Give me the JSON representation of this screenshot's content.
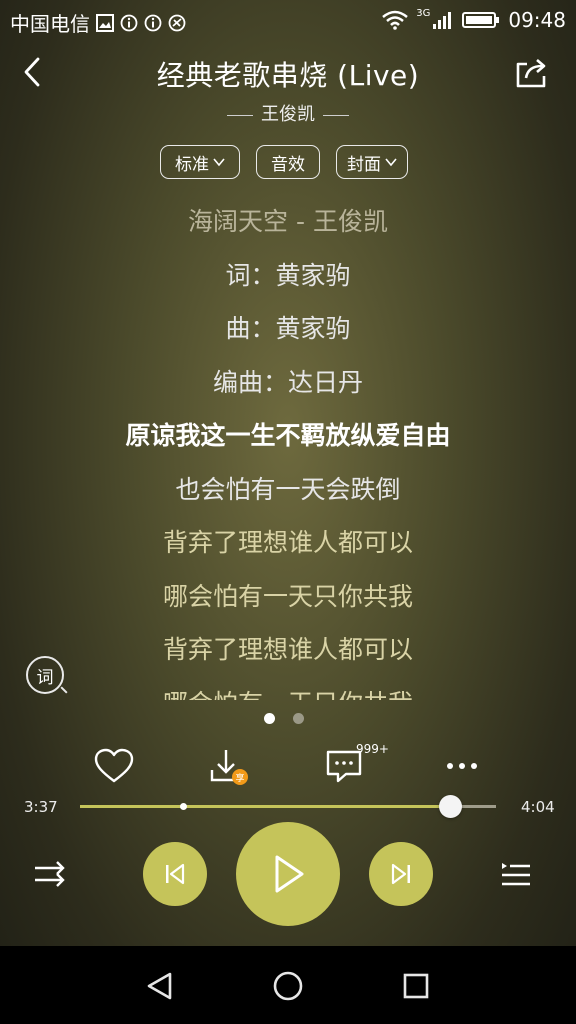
{
  "status_bar": {
    "carrier": "中国电信",
    "network": "3G",
    "time": "09:48"
  },
  "header": {
    "title": "经典老歌串烧 (Live)",
    "artist": "王俊凯"
  },
  "pills": [
    {
      "label": "标准",
      "has_dropdown": true
    },
    {
      "label": "音效",
      "has_dropdown": false
    },
    {
      "label": "封面",
      "has_dropdown": true
    }
  ],
  "lyrics": [
    "海阔天空 - 王俊凯",
    "词：黄家驹",
    "曲：黄家驹",
    "编曲：达日丹",
    "原谅我这一生不羁放纵爱自由",
    "也会怕有一天会跌倒",
    "背弃了理想谁人都可以",
    "哪会怕有一天只你共我",
    "背弃了理想谁人都可以",
    "哪会怕有一天只你共我"
  ],
  "lyrics_toggle_label": "词",
  "page_dots": {
    "count": 2,
    "active": 0
  },
  "actions": {
    "comment_count": "999+",
    "download_badge": "享"
  },
  "player": {
    "elapsed": "3:37",
    "duration": "4:04",
    "progress_fraction": 0.889,
    "buffer_fraction": 0.247
  },
  "colors": {
    "accent": "#c5c45a",
    "download_badge": "#f29a19",
    "nav_background": "#000000"
  },
  "icons": {
    "back": "chevron-left-icon",
    "share": "share-icon",
    "like": "heart-icon",
    "download": "download-icon",
    "comment": "comment-icon",
    "more": "more-icon",
    "shuffle": "shuffle-icon",
    "previous": "previous-icon",
    "play": "play-icon",
    "next": "next-icon",
    "playlist": "playlist-icon"
  }
}
